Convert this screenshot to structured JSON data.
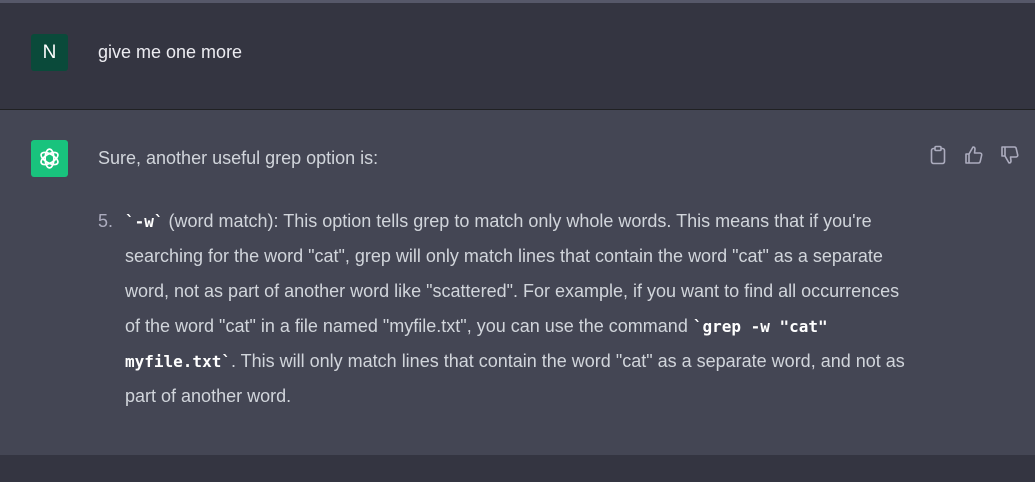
{
  "user_message": {
    "avatar_letter": "N",
    "text": "give me one more"
  },
  "assistant_message": {
    "intro": "Sure, another useful grep option is:",
    "list_item": {
      "number": "5.",
      "code_option": "`-w`",
      "text_1": " (word match): This option tells grep to match only whole words. This means that if you're searching for the word \"cat\", grep will only match lines that contain the word \"cat\" as a separate word, not as part of another word like \"scattered\". For example, if you want to find all occurrences of the word \"cat\" in a file named \"myfile.txt\", you can use the command ",
      "code_command": "`grep -w \"cat\" myfile.txt`",
      "text_2": ". This will only match lines that contain the word \"cat\" as a separate word, and not as part of another word."
    }
  },
  "actions": {
    "icons": [
      "clipboard-icon",
      "thumbs-up-icon",
      "thumbs-down-icon"
    ]
  },
  "colors": {
    "background": "#343541",
    "assistant_background": "#444654",
    "user_avatar": "#0a4a3a",
    "assistant_avatar": "#19c37d",
    "text": "#d1d5db"
  }
}
